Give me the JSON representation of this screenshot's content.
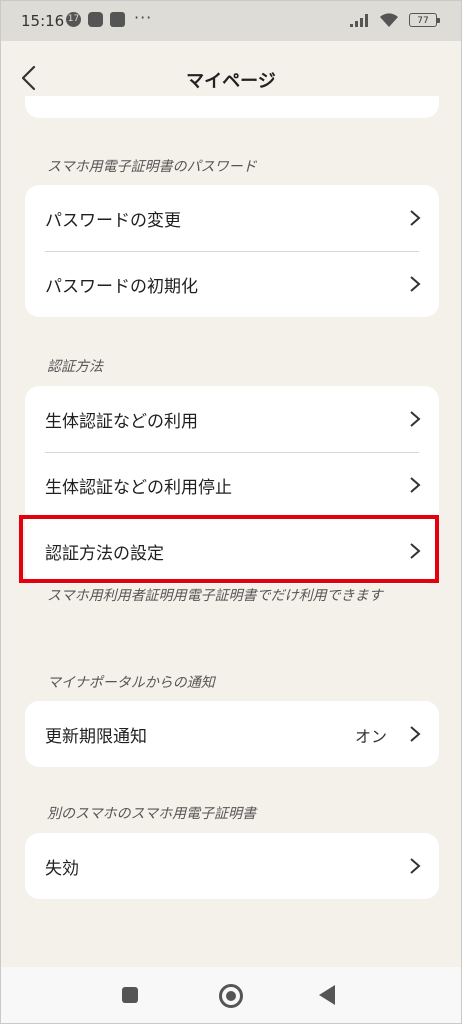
{
  "status_bar": {
    "time": "15:16",
    "icons": [
      "notification-17-icon",
      "line-icon",
      "mail-icon"
    ],
    "notif_badge": "17",
    "overflow": "···",
    "battery": "77"
  },
  "header": {
    "title": "マイページ"
  },
  "sections": [
    {
      "label": "スマホ用電子証明書のパスワード",
      "items": [
        {
          "label": "パスワードの変更"
        },
        {
          "label": "パスワードの初期化"
        }
      ]
    },
    {
      "label": "認証方法",
      "items": [
        {
          "label": "生体認証などの利用"
        },
        {
          "label": "生体認証などの利用停止"
        },
        {
          "label": "認証方法の設定"
        }
      ],
      "note": "スマホ用利用者証明用電子証明書でだけ利用できます"
    },
    {
      "label": "マイナポータルからの通知",
      "items": [
        {
          "label": "更新期限通知",
          "value": "オン"
        }
      ]
    },
    {
      "label": "別のスマホのスマホ用電子証明書",
      "items": [
        {
          "label": "失効"
        }
      ]
    }
  ],
  "colors": {
    "background": "#f4f1ea",
    "card": "#ffffff",
    "highlight": "#e3000f"
  }
}
